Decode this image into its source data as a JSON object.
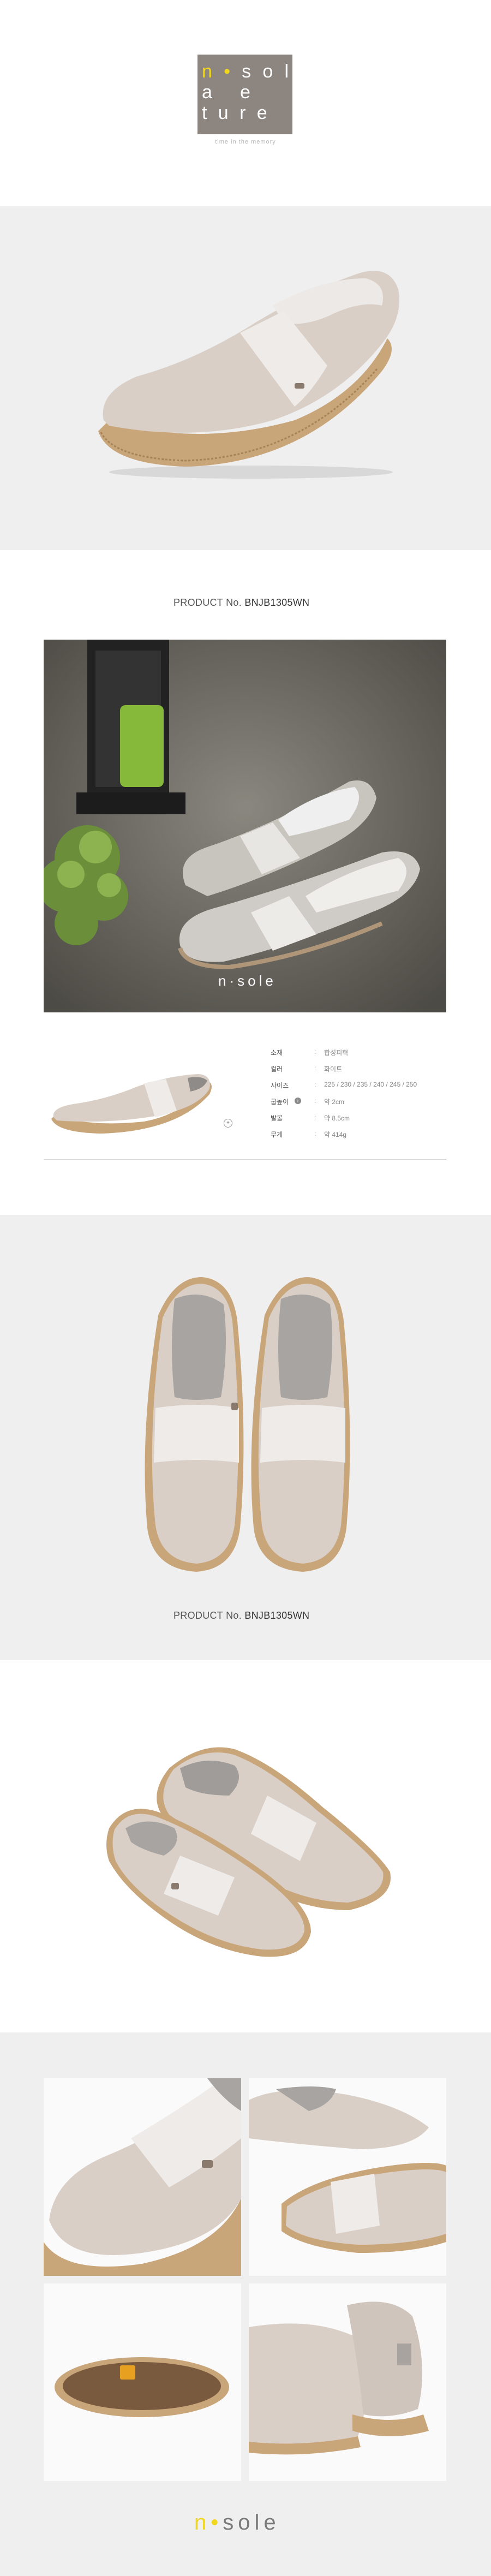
{
  "brand": {
    "logo_rows": [
      [
        "n",
        "•",
        "s",
        "o",
        "l"
      ],
      [
        "a",
        "",
        "e",
        "",
        ""
      ],
      [
        "t",
        "u",
        "r",
        "e",
        ""
      ]
    ],
    "tagline": "time in the memory",
    "accent_color": "#f2d81c",
    "logo_bg": "#8c8580"
  },
  "product": {
    "number_label": "PRODUCT No.",
    "number_value": "BNJB1305WN"
  },
  "hero_watermark": "n·sole",
  "specs": [
    {
      "label": "소재",
      "value": "합성피혁"
    },
    {
      "label": "컬러",
      "value": "화이트"
    },
    {
      "label": "사이즈",
      "value": "225 / 230 / 235 / 240 / 245 / 250"
    },
    {
      "label": "굽높이",
      "value": "약 2cm"
    },
    {
      "label": "발볼",
      "value": "약 8.5cm"
    },
    {
      "label": "무게",
      "value": "약 414g"
    }
  ],
  "footer_logo": {
    "prefix": "n",
    "dot": "•",
    "rest": "sole"
  }
}
